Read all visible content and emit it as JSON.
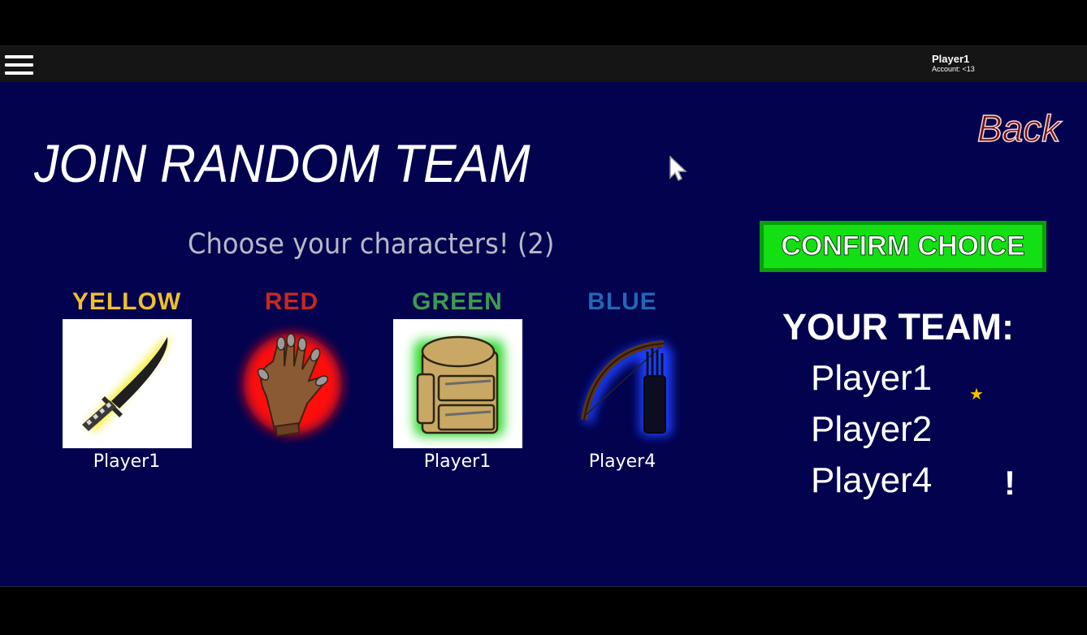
{
  "topbar": {
    "menu_icon": "hamburger-menu-icon",
    "account_name": "Player1",
    "account_sub": "Account: <13"
  },
  "game": {
    "title": "JOIN RANDOM TEAM",
    "back_label": "Back",
    "subtitle": "Choose your characters! (2)",
    "confirm_label": "CONFIRM CHOICE",
    "characters": [
      {
        "label": "YELLOW",
        "color": "#f0c02c",
        "item": "katana-icon",
        "player": "Player1",
        "selected": true
      },
      {
        "label": "RED",
        "color": "#c8281c",
        "item": "glove-icon",
        "player": "",
        "selected": false
      },
      {
        "label": "GREEN",
        "color": "#3f9a4c",
        "item": "backpack-icon",
        "player": "Player1",
        "selected": true
      },
      {
        "label": "BLUE",
        "color": "#2366b4",
        "item": "bow-icon",
        "player": "Player4",
        "selected": false
      }
    ],
    "team": {
      "heading": "YOUR TEAM:",
      "members": [
        "Player1",
        "Player2",
        "Player4"
      ],
      "star_icon": "star-icon",
      "star_glyph": "★",
      "alert_icon": "exclamation-icon",
      "alert_glyph": "!"
    }
  }
}
